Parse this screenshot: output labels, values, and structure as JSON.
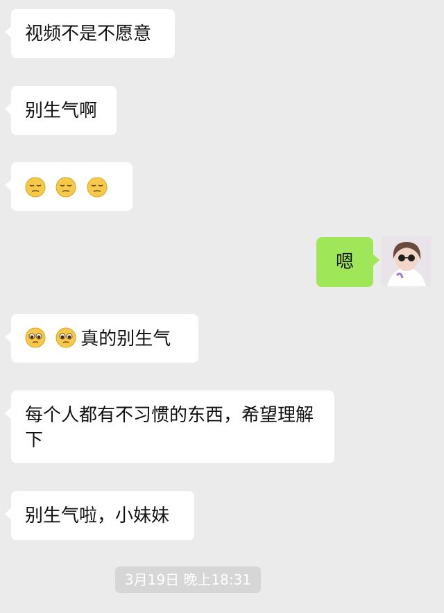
{
  "messages": [
    {
      "id": "m1",
      "text": "视频不是不愿意"
    },
    {
      "id": "m2",
      "text": "别生气啊"
    },
    {
      "id": "m3",
      "emoji_name": "pensive-face-emoji",
      "emoji_count": 3
    },
    {
      "id": "m4",
      "text": "嗯"
    },
    {
      "id": "m5",
      "emoji_name": "pleading-face-emoji",
      "emoji_count": 2,
      "text": "真的别生气"
    },
    {
      "id": "m6",
      "text": "每个人都有不习惯的东西，希望理解下"
    },
    {
      "id": "m7",
      "text": "别生气啦，小妹妹"
    }
  ],
  "timestamp": "3月19日 晚上18:31",
  "colors": {
    "background": "#ebebeb",
    "incoming_bubble": "#ffffff",
    "outgoing_bubble": "#9fe659",
    "timestamp_pill": "#d6d6d6"
  }
}
